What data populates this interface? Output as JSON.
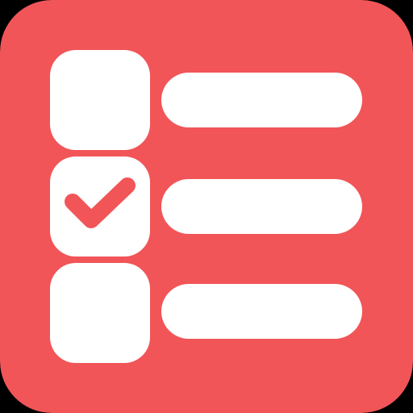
{
  "icon": {
    "name": "checklist-app-icon",
    "background_color": "#F15558",
    "foreground_color": "#FFFFFF",
    "check_color": "#F15558",
    "rows": [
      {
        "checkbox": "checkbox-empty-icon",
        "checked": false,
        "line": "list-line"
      },
      {
        "checkbox": "checkbox-checked-icon",
        "checked": true,
        "line": "list-line"
      },
      {
        "checkbox": "checkbox-empty-icon",
        "checked": false,
        "line": "list-line"
      }
    ]
  }
}
